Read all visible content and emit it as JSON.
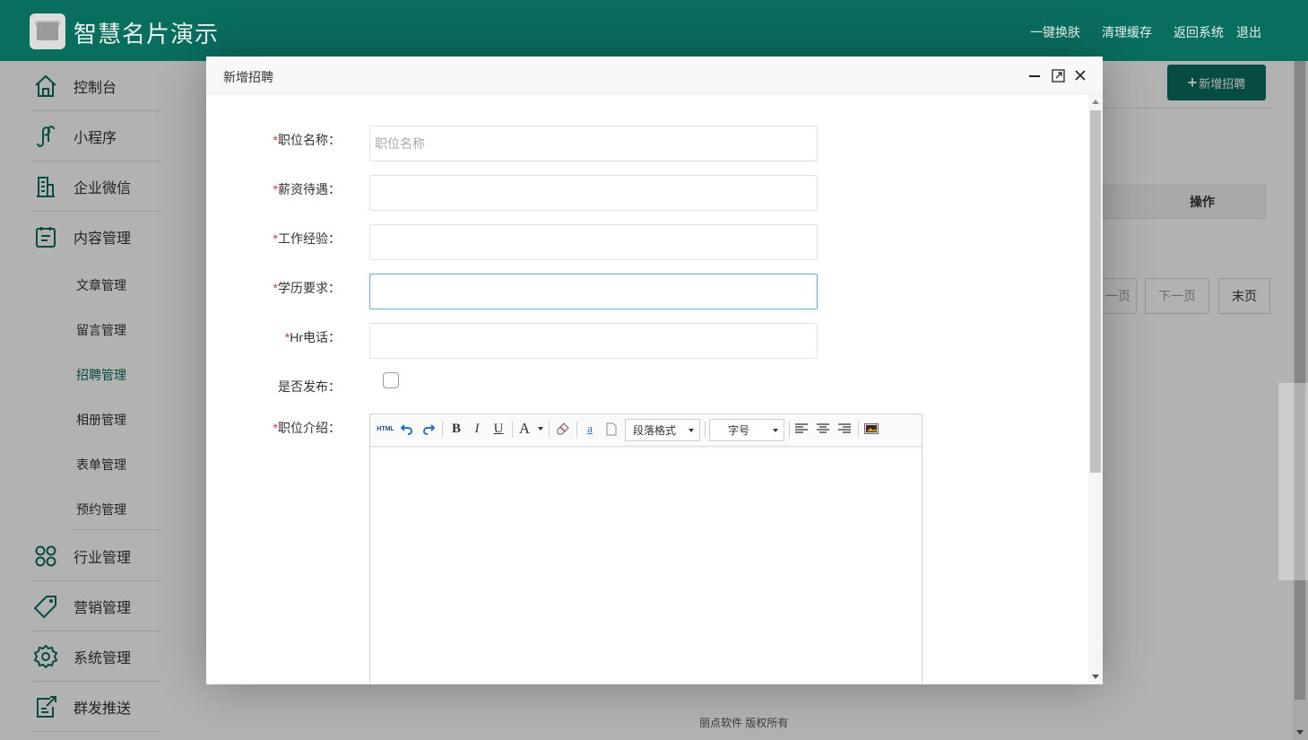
{
  "header": {
    "app_title": "智慧名片演示",
    "links": [
      "一键换肤",
      "清理缓存",
      "返回系统",
      "退出"
    ]
  },
  "sidebar": {
    "items": [
      {
        "label": "控制台",
        "icon": "home-icon"
      },
      {
        "label": "小程序",
        "icon": "miniprogram-icon"
      },
      {
        "label": "企业微信",
        "icon": "building-icon"
      },
      {
        "label": "内容管理",
        "icon": "clipboard-icon"
      },
      {
        "label": "行业管理",
        "icon": "apps-icon"
      },
      {
        "label": "营销管理",
        "icon": "tag-icon"
      },
      {
        "label": "系统管理",
        "icon": "gear-icon"
      },
      {
        "label": "群发推送",
        "icon": "send-icon"
      }
    ],
    "content_sub": [
      "文章管理",
      "留言管理",
      "招聘管理",
      "相册管理",
      "表单管理",
      "预约管理"
    ],
    "active_sub": "招聘管理"
  },
  "main": {
    "new_button": "新增招聘",
    "table_header_action": "操作",
    "pagination": [
      "一页",
      "下一页",
      "末页"
    ],
    "footer": "丽点软件 版权所有"
  },
  "modal": {
    "title": "新增招聘",
    "fields": {
      "position_name": {
        "label": "职位名称：",
        "placeholder": "职位名称",
        "value": ""
      },
      "salary": {
        "label": "薪资待遇：",
        "value": ""
      },
      "experience": {
        "label": "工作经验：",
        "value": ""
      },
      "education": {
        "label": "学历要求：",
        "value": ""
      },
      "hr_phone": {
        "label": "Hr电话：",
        "value": ""
      },
      "publish": {
        "label": "是否发布：",
        "checked": false
      },
      "intro": {
        "label": "职位介绍："
      }
    },
    "required_mark": "*",
    "editor": {
      "html_label": "HTML",
      "bold": "B",
      "italic": "I",
      "underline": "U",
      "font_color": "A",
      "anchor": "a",
      "paragraph_format": "段落格式",
      "font_size": "字号"
    }
  },
  "colors": {
    "brand": "#0a6e5f",
    "required": "#ee3333",
    "focus_border": "#5fb1d8"
  }
}
